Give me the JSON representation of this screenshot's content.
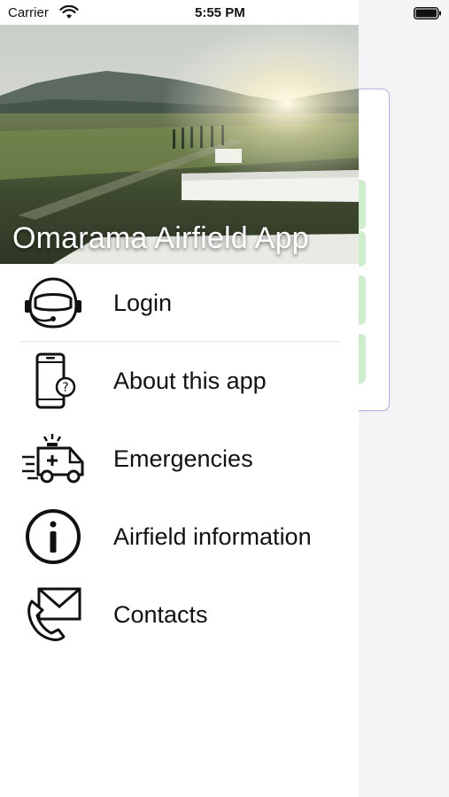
{
  "status_bar": {
    "carrier": "Carrier",
    "time": "5:55 PM",
    "wifi_icon": "wifi-icon",
    "battery_icon": "battery-icon"
  },
  "drawer": {
    "header_title": "Omarama Airfield App",
    "menu_items": [
      {
        "label": "Login",
        "icon": "pilot-helmet-icon"
      },
      {
        "label": "About this app",
        "icon": "phone-question-icon"
      },
      {
        "label": "Emergencies",
        "icon": "ambulance-icon"
      },
      {
        "label": "Airfield information",
        "icon": "info-icon"
      },
      {
        "label": "Contacts",
        "icon": "envelope-phone-icon"
      }
    ]
  },
  "colors": {
    "background_card_border": "#b9b4e6",
    "background_tile": "#cfeccf"
  }
}
